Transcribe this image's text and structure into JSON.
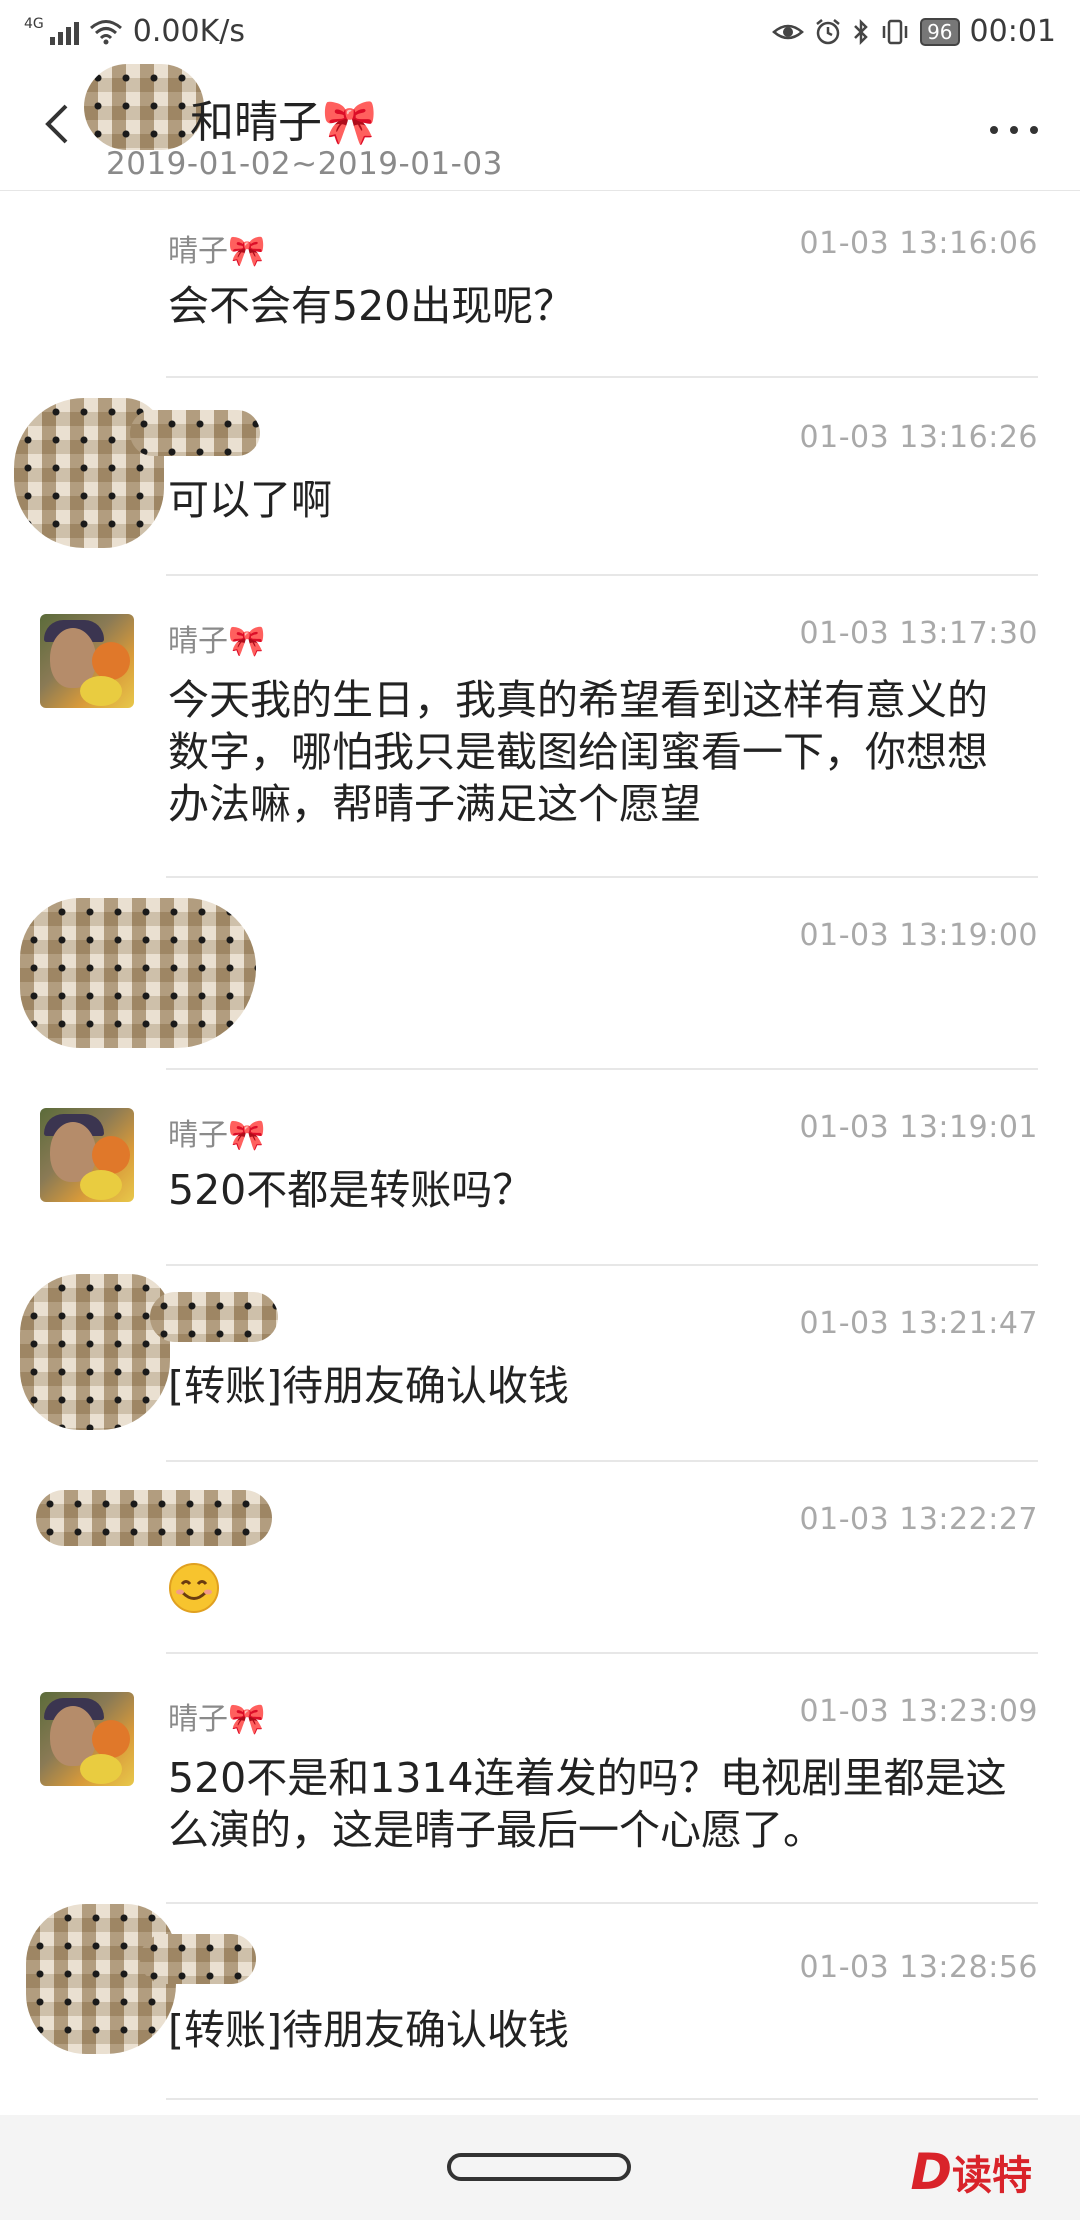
{
  "status_bar": {
    "network_type": "4G",
    "speed": "0.00K/s",
    "battery": "96",
    "time": "00:01"
  },
  "header": {
    "title": "和晴子",
    "title_emoji": "🎀",
    "date_range": "2019-01-02~2019-01-03"
  },
  "messages": [
    {
      "sender": "晴子",
      "time": "01-03 13:16:06",
      "text": "会不会有520出现呢？"
    },
    {
      "sender": "",
      "time": "01-03 13:16:26",
      "text": "可以了啊"
    },
    {
      "sender": "晴子",
      "time": "01-03 13:17:30",
      "text": "今天我的生日，我真的希望看到这样有意义的数字，哪怕我只是截图给闺蜜看一下，你想想办法嘛，帮晴子满足这个愿望"
    },
    {
      "sender": "",
      "time": "01-03 13:19:00",
      "text": ""
    },
    {
      "sender": "晴子",
      "time": "01-03 13:19:01",
      "text": "520不都是转账吗？"
    },
    {
      "sender": "",
      "time": "01-03 13:21:47",
      "text": "[转账]待朋友确认收钱"
    },
    {
      "sender": "",
      "time": "01-03 13:22:27",
      "text": ""
    },
    {
      "sender": "晴子",
      "time": "01-03 13:23:09",
      "text": "520不是和1314连着发的吗？电视剧里都是这么演的，这是晴子最后一个心愿了。"
    },
    {
      "sender": "",
      "time": "01-03 13:28:56",
      "text": "[转账]待朋友确认收钱"
    }
  ],
  "sender_emoji": "🎀",
  "watermark": {
    "letter": "D",
    "text": "读特"
  }
}
